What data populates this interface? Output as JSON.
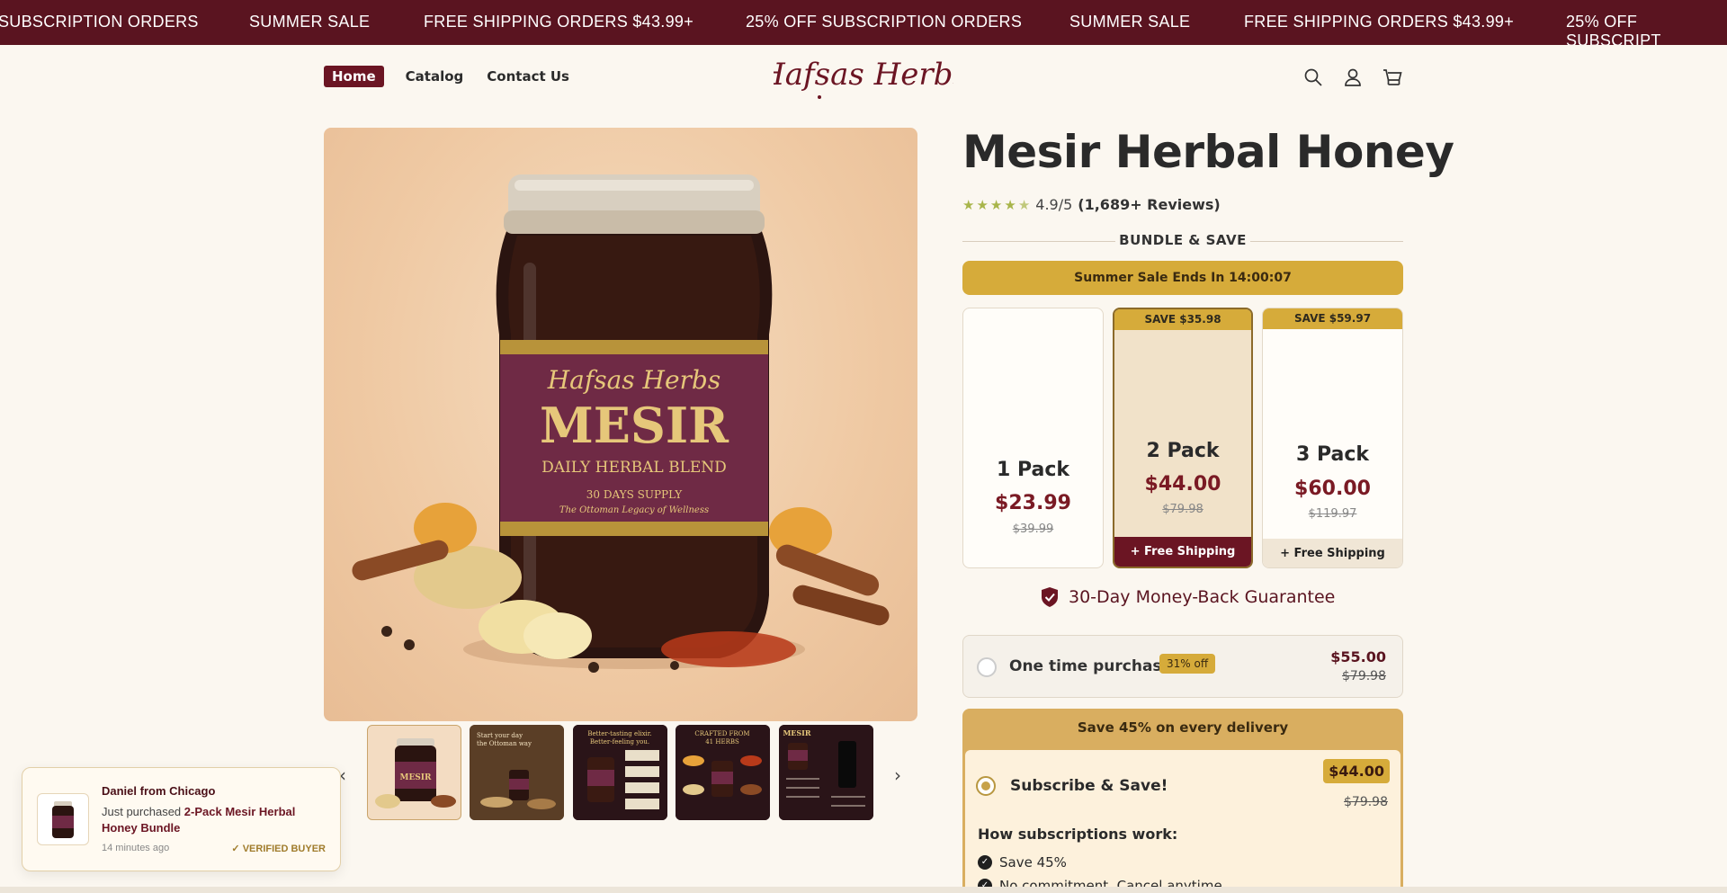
{
  "announcement": {
    "items": [
      "SUBSCRIPTION ORDERS",
      "SUMMER SALE",
      "FREE SHIPPING ORDERS $43.99+",
      "25% OFF SUBSCRIPTION ORDERS",
      "SUMMER SALE",
      "FREE SHIPPING ORDERS $43.99+",
      "25% OFF SUBSCRIPT"
    ]
  },
  "nav": {
    "items": [
      {
        "label": "Home",
        "active": true
      },
      {
        "label": "Catalog",
        "active": false
      },
      {
        "label": "Contact Us",
        "active": false
      }
    ]
  },
  "logo": {
    "text": "Hafsas Herbs"
  },
  "header_icons": [
    "search-icon",
    "account-icon",
    "cart-icon"
  ],
  "product_image": {
    "jar_brand": "Hafsas Herbs",
    "jar_name": "MESIR",
    "jar_subtitle": "DAILY HERBAL BLEND",
    "jar_supply": "30 DAYS SUPPLY",
    "jar_tagline": "The Ottoman Legacy of Wellness"
  },
  "thumbnails": [
    {
      "caption": ""
    },
    {
      "caption": "Start your day the Ottoman way"
    },
    {
      "caption": "Better-tasting elixir. Better-feeling you."
    },
    {
      "caption": "CRAFTED FROM 41 HERBS"
    },
    {
      "caption": "MESIR"
    }
  ],
  "toast": {
    "name": "Daniel from Chicago",
    "prefix": "Just purchased",
    "product": "2-Pack Mesir Herbal Honey Bundle",
    "time": "14 minutes ago",
    "verified": "✓ VERIFIED BUYER"
  },
  "product": {
    "title": "Mesir Herbal Honey",
    "rating_score": "4.9/5",
    "rating_reviews": "(1,689+ Reviews)",
    "stars": 4.5
  },
  "bundle": {
    "heading": "BUNDLE & SAVE",
    "sale_bar": "Summer Sale Ends In 14:00:07",
    "packs": [
      {
        "name": "1 Pack",
        "price": "$23.99",
        "old": "$39.99",
        "badge": "",
        "shipping": ""
      },
      {
        "name": "2 Pack",
        "price": "$44.00",
        "old": "$79.98",
        "badge": "SAVE $35.98",
        "shipping": "+ Free Shipping"
      },
      {
        "name": "3 Pack",
        "price": "$60.00",
        "old": "$119.97",
        "badge": "SAVE $59.97",
        "shipping": "+ Free Shipping"
      }
    ]
  },
  "guarantee": "30-Day Money-Back Guarantee",
  "one_time": {
    "label": "One time purchase",
    "badge": "31% off",
    "price": "$55.00",
    "old": "$79.98"
  },
  "subscribe": {
    "header": "Save 45% on every delivery",
    "label": "Subscribe & Save!",
    "price": "$44.00",
    "old": "$79.98",
    "how_title": "How subscriptions work:",
    "benefits": [
      "Save 45%",
      "No commitment. Cancel anytime"
    ]
  },
  "colors": {
    "brand_maroon": "#6b1523",
    "gold": "#d6ab3a",
    "background": "#fbf7f0"
  }
}
